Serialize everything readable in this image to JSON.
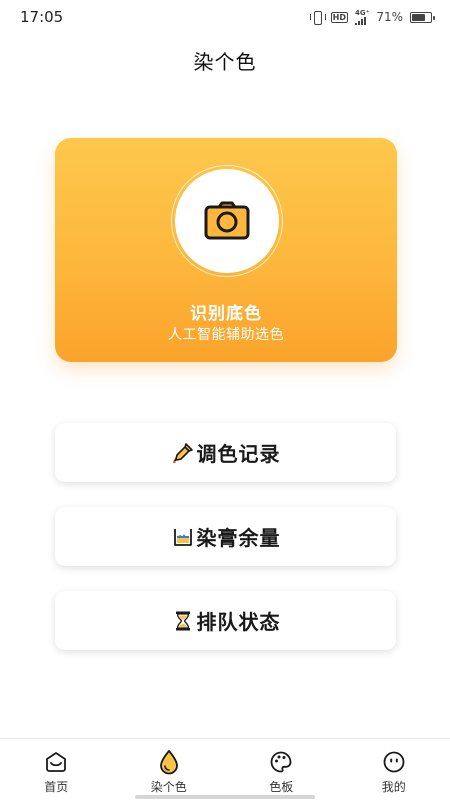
{
  "status_bar": {
    "time": "17:05",
    "hd": "HD",
    "network": "4G⁺",
    "battery": "71%",
    "battery_level": 0.71
  },
  "header": {
    "title": "染个色"
  },
  "hero": {
    "icon": "camera-icon",
    "title": "识别底色",
    "subtitle": "人工智能辅助选色",
    "accent": "#fdb73c"
  },
  "menu": {
    "items": [
      {
        "icon": "dropper-icon",
        "label": "调色记录"
      },
      {
        "icon": "container-icon",
        "label": "染膏余量"
      },
      {
        "icon": "hourglass-icon",
        "label": "排队状态"
      }
    ]
  },
  "tabs": {
    "active_index": 1,
    "items": [
      {
        "icon": "home-icon",
        "label": "首页"
      },
      {
        "icon": "drop-icon",
        "label": "染个色"
      },
      {
        "icon": "palette-icon",
        "label": "色板"
      },
      {
        "icon": "face-icon",
        "label": "我的"
      }
    ]
  }
}
